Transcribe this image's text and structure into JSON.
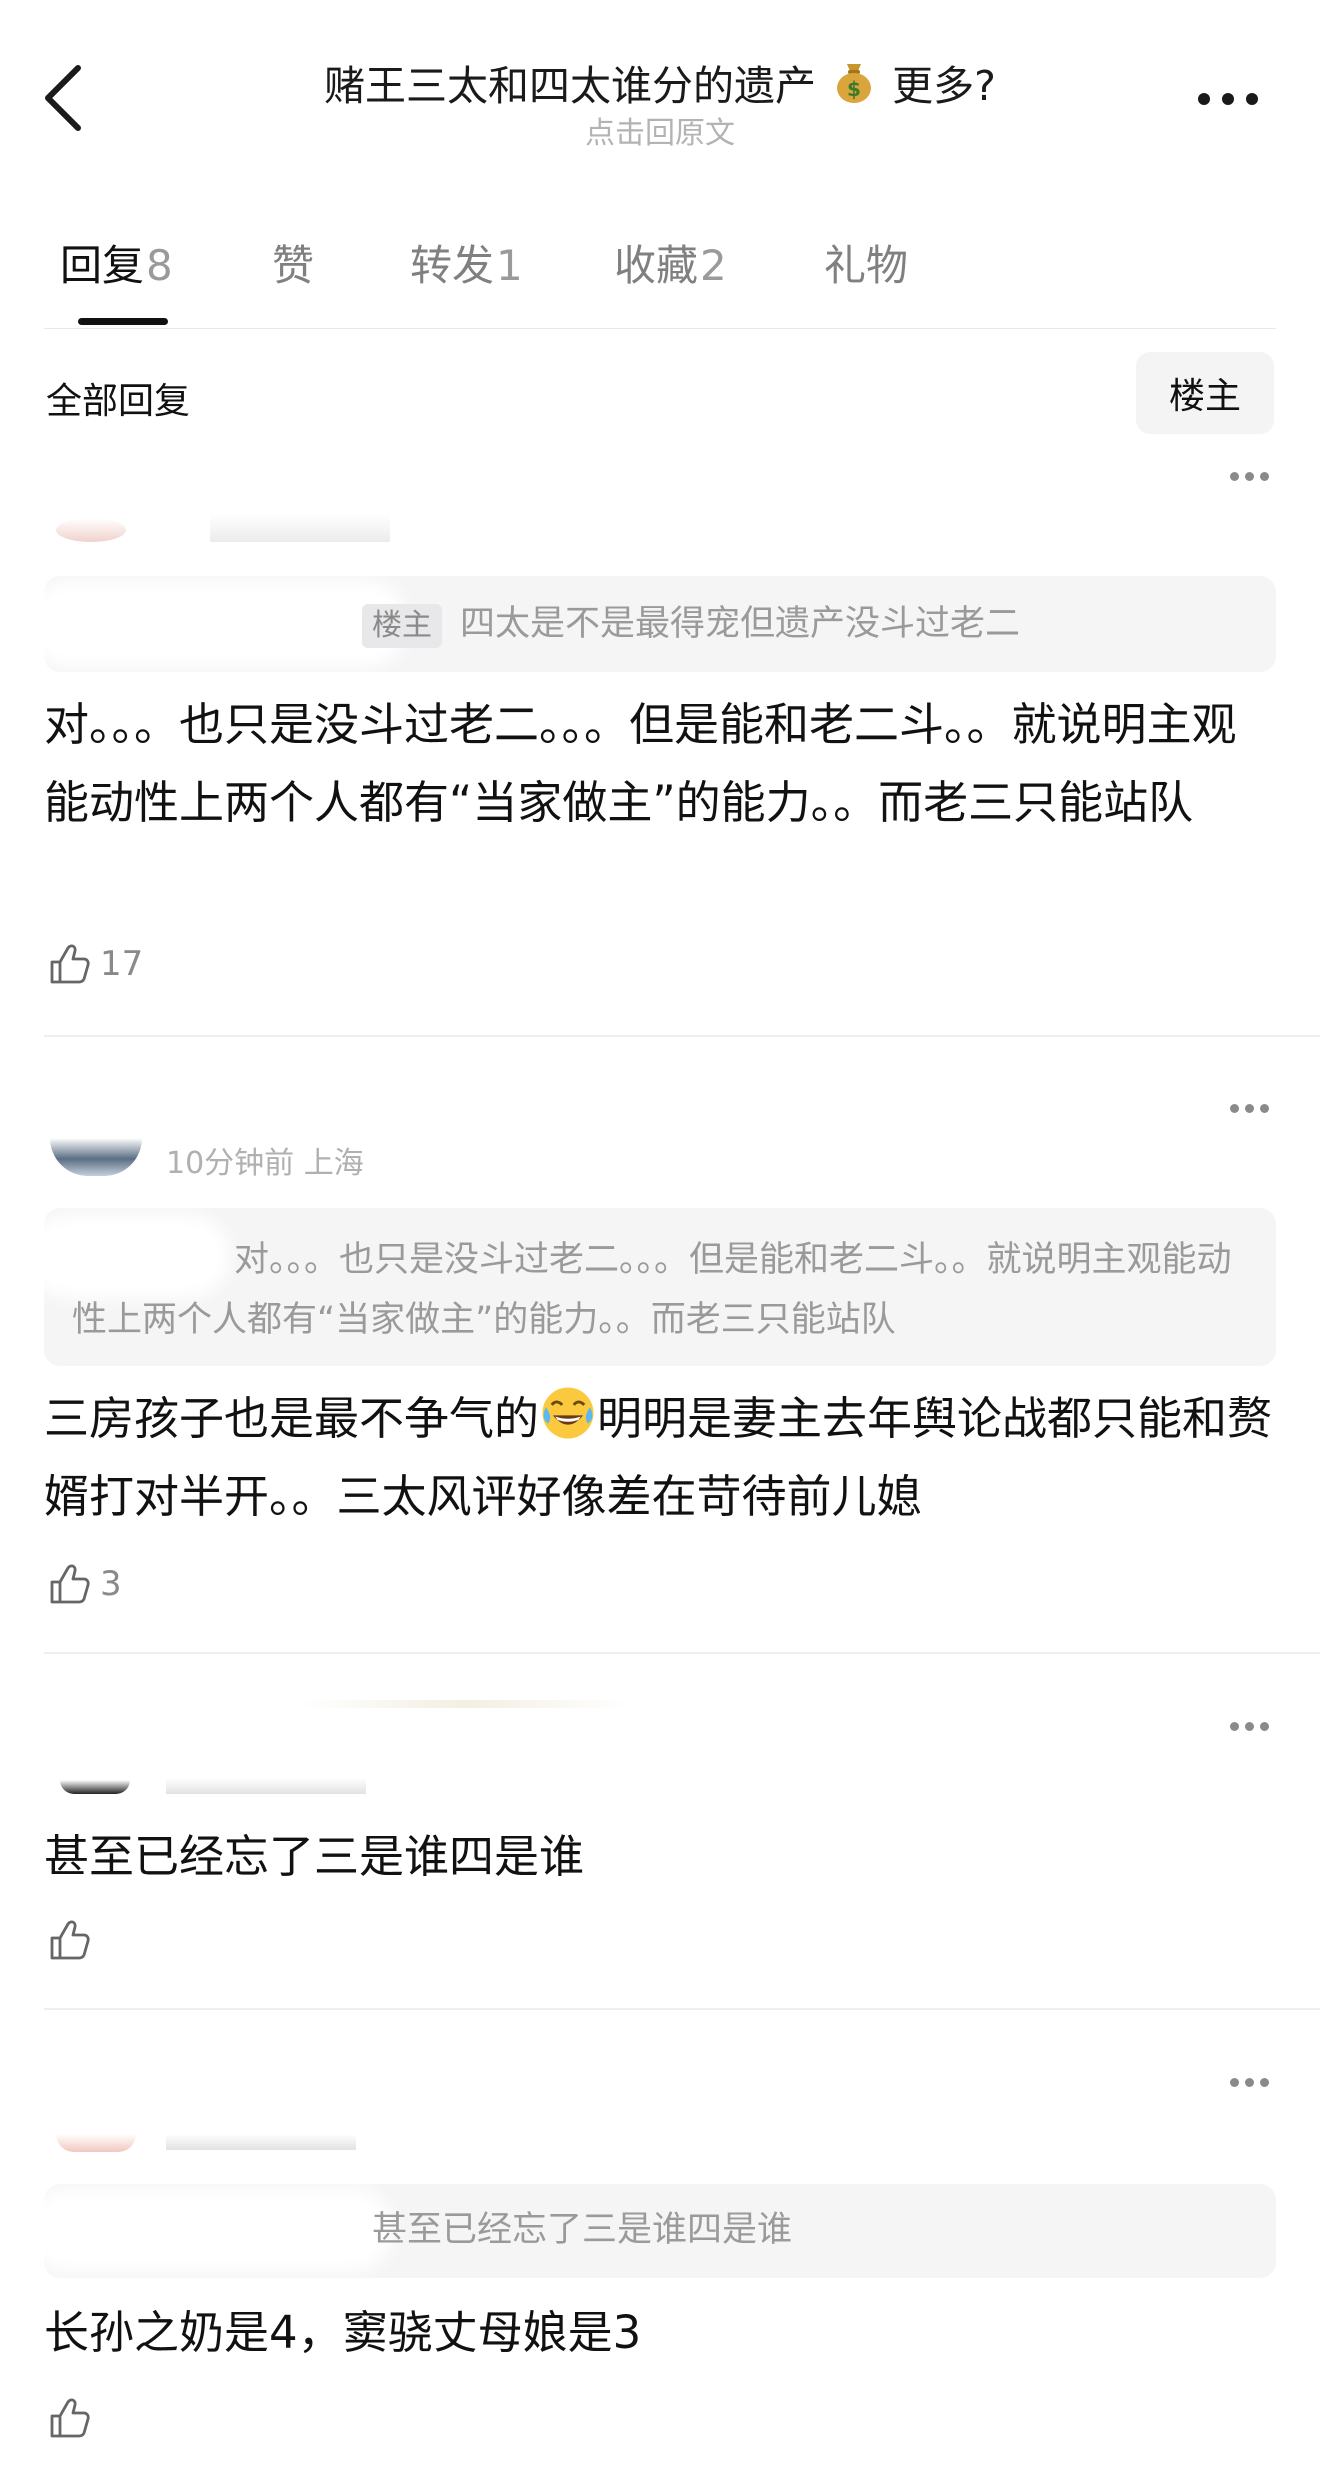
{
  "header": {
    "title": "赌王三太和四太谁分的遗产",
    "title_suffix": "更多?",
    "title_emoji": "money-bag",
    "subtitle": "点击回原文"
  },
  "tabs": [
    {
      "label": "回复",
      "count": "8",
      "active": true
    },
    {
      "label": "赞",
      "count": ""
    },
    {
      "label": "转发",
      "count": "1"
    },
    {
      "label": "收藏",
      "count": "2"
    },
    {
      "label": "礼物",
      "count": ""
    }
  ],
  "filter": {
    "all_label": "全部回复",
    "op_label": "楼主"
  },
  "comments": [
    {
      "meta": "",
      "quote_tag": "楼主",
      "quote": "四太是不是最得宠但遗产没斗过老二",
      "text": "对。。。也只是没斗过老二。。。但是能和老二斗。。就说明主观能动性上两个人都有“当家做主”的能力。。而老三只能站队",
      "likes": "17"
    },
    {
      "meta": "10分钟前 上海",
      "quote": "对。。。也只是没斗过老二。。。但是能和老二斗。。就说明主观能动性上两个人都有“当家做主”的能力。。而老三只能站队",
      "text_before_emoji": "三房孩子也是最不争气的",
      "text_after_emoji": "明明是妻主去年舆论战都只能和赘婿打对半开。。三太风评好像差在苛待前儿媳",
      "likes": "3"
    },
    {
      "meta": "",
      "text": "甚至已经忘了三是谁四是谁",
      "likes": ""
    },
    {
      "meta": "",
      "quote": "甚至已经忘了三是谁四是谁",
      "text": "长孙之奶是4，窦骁丈母娘是3",
      "likes": ""
    }
  ],
  "colors": {
    "text": "#111111",
    "muted": "#9a9a9a",
    "quote_bg": "#f5f5f6",
    "divider": "#eeeeee"
  }
}
